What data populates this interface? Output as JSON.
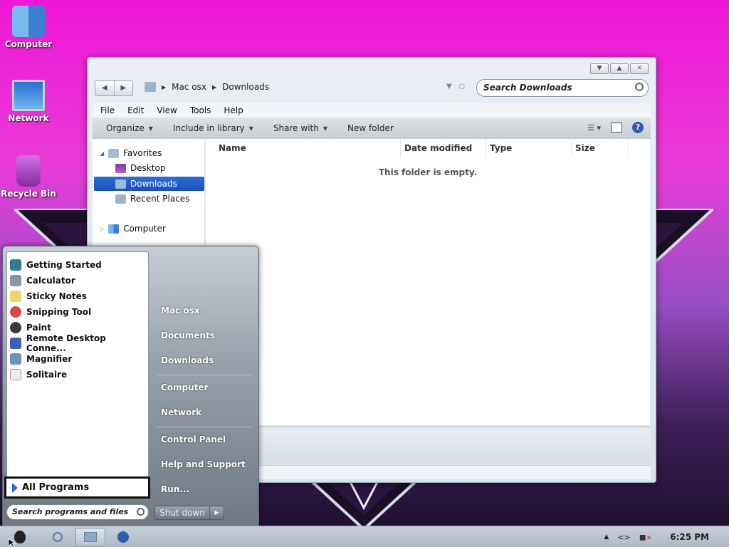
{
  "desktop": {
    "icons": [
      {
        "label": "Computer"
      },
      {
        "label": "Network"
      },
      {
        "label": "Recycle Bin"
      }
    ]
  },
  "explorer": {
    "breadcrumb": [
      "Mac osx",
      "Downloads"
    ],
    "search_placeholder": "Search Downloads",
    "menu": [
      "File",
      "Edit",
      "View",
      "Tools",
      "Help"
    ],
    "toolbar": {
      "organize": "Organize",
      "include_in_library": "Include in library",
      "share_with": "Share with",
      "new_folder": "New folder"
    },
    "nav": {
      "favorites": "Favorites",
      "desktop": "Desktop",
      "downloads": "Downloads",
      "recent_places": "Recent Places",
      "computer": "Computer"
    },
    "columns": {
      "name": "Name",
      "date_modified": "Date modified",
      "type": "Type",
      "size": "Size"
    },
    "empty_message": "This folder is empty."
  },
  "start_menu": {
    "programs": [
      {
        "label": "Getting Started",
        "icon": "getting-started-icon"
      },
      {
        "label": "Calculator",
        "icon": "calculator-icon"
      },
      {
        "label": "Sticky Notes",
        "icon": "sticky-notes-icon"
      },
      {
        "label": "Snipping Tool",
        "icon": "snipping-tool-icon"
      },
      {
        "label": "Paint",
        "icon": "paint-icon"
      },
      {
        "label": "Remote Desktop Conne...",
        "icon": "remote-desktop-icon"
      },
      {
        "label": "Magnifier",
        "icon": "magnifier-icon"
      },
      {
        "label": "Solitaire",
        "icon": "solitaire-icon"
      }
    ],
    "all_programs": "All Programs",
    "search_placeholder": "Search programs and files",
    "right": {
      "user": "Mac osx",
      "documents": "Documents",
      "downloads": "Downloads",
      "computer": "Computer",
      "network": "Network",
      "control_panel": "Control Panel",
      "help_support": "Help and Support",
      "run": "Run..."
    },
    "shutdown": "Shut down"
  },
  "taskbar": {
    "clock": "6:25 PM"
  },
  "colors": {
    "selection": "#2c6fd5",
    "desktop_top": "#f017d8"
  }
}
